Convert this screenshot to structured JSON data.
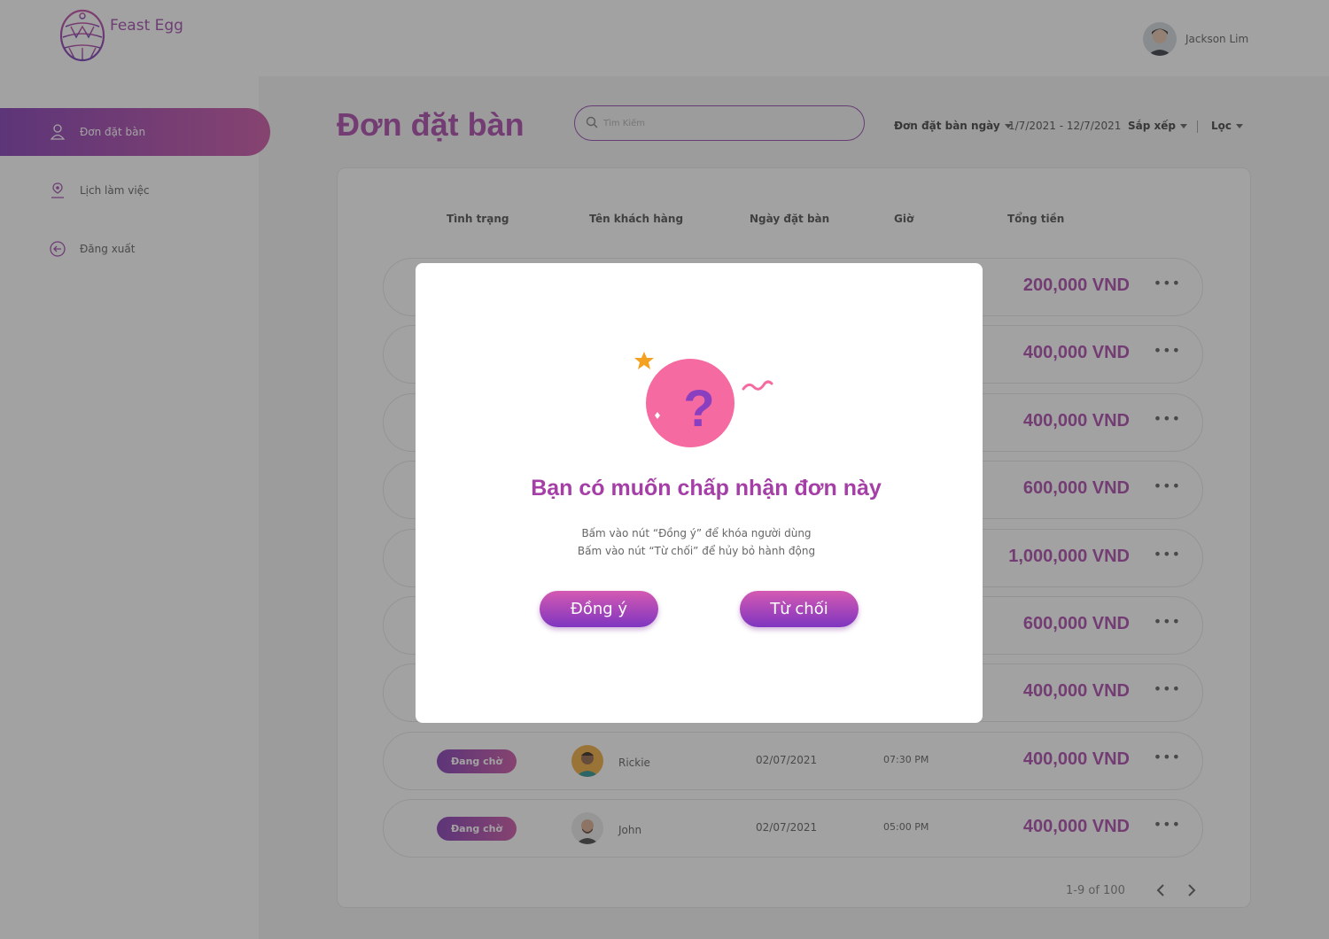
{
  "app": {
    "name": "Feast Egg"
  },
  "user": {
    "name": "Jackson Lim"
  },
  "sidebar": {
    "items": [
      {
        "label": "Đơn đặt bàn",
        "icon": "user-icon",
        "active": true
      },
      {
        "label": "Lịch làm việc",
        "icon": "user-location-icon",
        "active": false
      },
      {
        "label": "Đăng xuất",
        "icon": "logout-icon",
        "active": false
      }
    ]
  },
  "main": {
    "title": "Đơn đặt bàn",
    "search": {
      "placeholder": "Tìm Kiếm",
      "value": ""
    },
    "filters": {
      "date_filter_label": "Đơn đặt bàn ngày",
      "date_range": "1/7/2021 - 12/7/2021",
      "sort_label": "Sắp xếp",
      "filter_label": "Lọc"
    },
    "table": {
      "headers": [
        "Tình trạng",
        "Tên khách hàng",
        "Ngày đặt bàn",
        "Giờ",
        "Tổng tiền"
      ],
      "rows": [
        {
          "total": "200,000 VND"
        },
        {
          "total": "400,000 VND"
        },
        {
          "total": "400,000 VND"
        },
        {
          "total": "600,000 VND"
        },
        {
          "total": "1,000,000 VND"
        },
        {
          "total": "600,000 VND"
        },
        {
          "total": "400,000 VND"
        },
        {
          "status": "Đang chờ",
          "customer": "Rickie",
          "date": "02/07/2021",
          "time": "07:30 PM",
          "total": "400,000 VND"
        },
        {
          "status": "Đang chờ",
          "customer": "John",
          "date": "02/07/2021",
          "time": "05:00 PM",
          "total": "400,000 VND"
        }
      ]
    },
    "pagination": {
      "label": "1-9 of 100"
    }
  },
  "modal": {
    "title": "Bạn có muốn chấp nhận đơn này",
    "line1": "Bấm vào nút “Đồng ý” để khóa người dùng",
    "line2": "Bấm vào nút “Từ chối” để hủy bỏ hành động",
    "accept_label": "Đồng ý",
    "reject_label": "Từ chối"
  },
  "colors": {
    "accent": "#a53ea6",
    "gradient_start": "#7b2fb0",
    "gradient_end": "#c94aa0",
    "illustration_pink": "#f56aa0"
  }
}
